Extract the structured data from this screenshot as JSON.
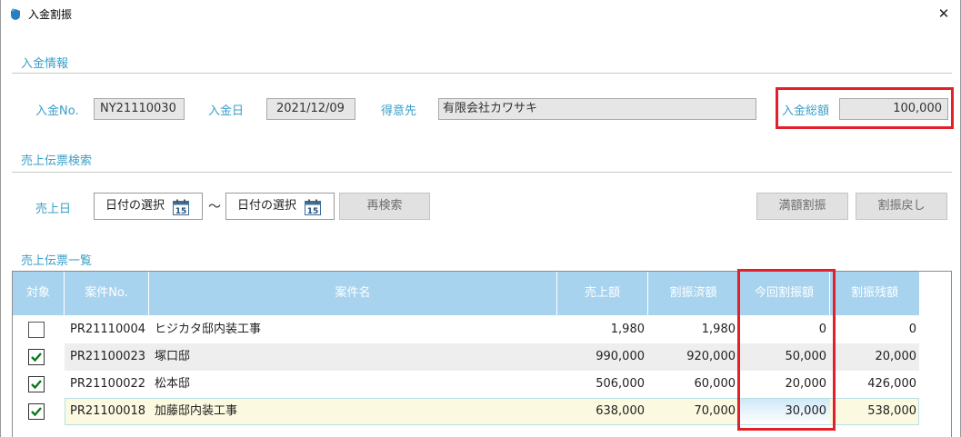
{
  "window": {
    "title": "入金割振",
    "close_glyph": "✕"
  },
  "payment_info": {
    "section_title": "入金情報",
    "payment_no_label": "入金No.",
    "payment_no": "NY21110030",
    "payment_date_label": "入金日",
    "payment_date": "2021/12/09",
    "customer_label": "得意先",
    "customer": "有限会社カワサキ",
    "total_label": "入金総額",
    "total": "100,000"
  },
  "search": {
    "section_title": "売上伝票検索",
    "date_label": "売上日",
    "from_date": "日付の選択",
    "to_date": "日付の選択",
    "range_sep": "～",
    "research_button": "再検索",
    "full_allocate_button": "満額割振",
    "undo_allocate_button": "割振戻し"
  },
  "list": {
    "section_title": "売上伝票一覧",
    "columns": [
      "対象",
      "案件No.",
      "案件名",
      "売上額",
      "割振済額",
      "今回割振額",
      "割振残額"
    ],
    "rows": [
      {
        "checked": false,
        "no": "PR21110004",
        "name": "ヒジカタ邸内装工事",
        "sales": "1,980",
        "allocated": "1,980",
        "current": "0",
        "remaining": "0"
      },
      {
        "checked": true,
        "no": "PR21100023",
        "name": "塚口邸",
        "sales": "990,000",
        "allocated": "920,000",
        "current": "50,000",
        "remaining": "20,000"
      },
      {
        "checked": true,
        "no": "PR21100022",
        "name": "松本邸",
        "sales": "506,000",
        "allocated": "60,000",
        "current": "20,000",
        "remaining": "426,000"
      },
      {
        "checked": true,
        "no": "PR21100018",
        "name": "加藤邸内装工事",
        "sales": "638,000",
        "allocated": "70,000",
        "current": "30,000",
        "remaining": "538,000"
      }
    ]
  },
  "colors": {
    "accent": "#3a9fc8",
    "header_bg": "#a8d3ee",
    "highlight": "#e3202a"
  }
}
